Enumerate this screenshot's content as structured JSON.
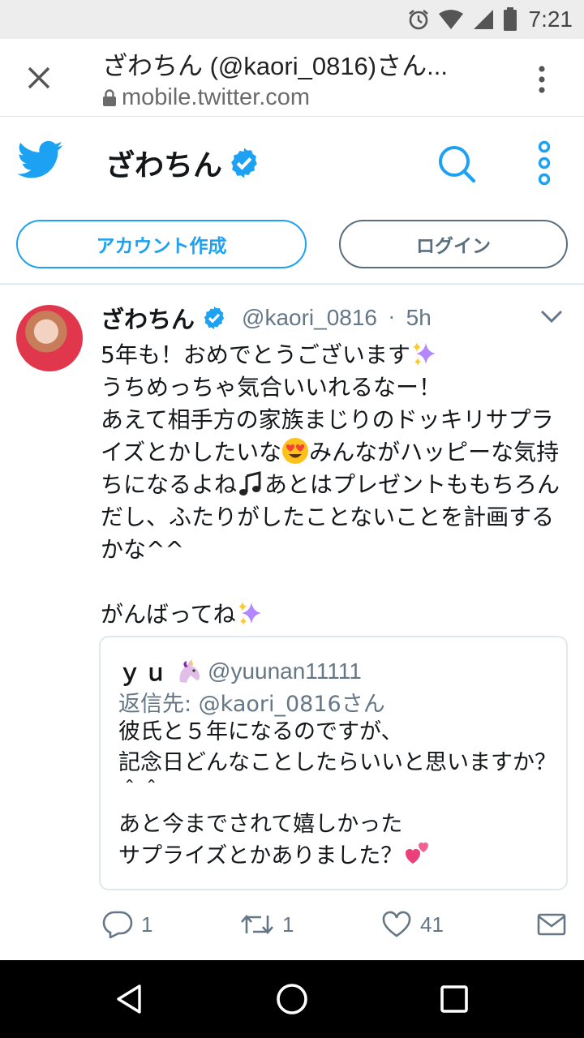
{
  "status_bar": {
    "time": "7:21"
  },
  "browser": {
    "page_title": "ざわちん (@kaori_0816)さん...",
    "url": "mobile.twitter.com"
  },
  "header": {
    "profile_name": "ざわちん",
    "signup_label": "アカウント作成",
    "login_label": "ログイン"
  },
  "tweet": {
    "name": "ざわちん",
    "handle": "@kaori_0816",
    "separator": "·",
    "time": "5h",
    "text_part1": "5年も！おめでとうございます",
    "text_part2": "\nうちめっちゃ気合いいれるなー！\nあえて相手方の家族まじりのドッキリサプライズとかしたいな",
    "text_part3": "みんながハッピーな気持ちになるよね",
    "text_part4": "あとはプレゼントももちろんだし、ふたりがしたことないことを計画するかな^^\n\nがんばってね",
    "quote": {
      "name": "ｙｕ",
      "handle": "@yuunan11111",
      "reply_to": "返信先: @kaori_0816さん",
      "text": "彼氏と５年になるのですが、\n記念日どんなことしたらいいと思いますか？＾＾\nあと今までされて嬉しかった\nサプライズとかありました？"
    },
    "actions": {
      "replies": "1",
      "retweets": "1",
      "likes": "41"
    }
  },
  "colors": {
    "twitter_blue": "#1da1f2",
    "secondary_text": "#657786",
    "status_bar_bg": "#ededed",
    "nav_bar_bg": "#000000"
  },
  "icons": [
    "alarm-icon",
    "wifi-icon",
    "signal-icon",
    "battery-icon",
    "close-icon",
    "lock-icon",
    "overflow-menu-icon",
    "twitter-bird-icon",
    "verified-badge-icon",
    "search-icon",
    "more-vertical-icon",
    "chevron-down-icon",
    "sparkles-emoji",
    "heart-eyes-emoji",
    "music-note-emoji",
    "unicorn-emoji",
    "two-hearts-emoji",
    "reply-icon",
    "retweet-icon",
    "like-icon",
    "direct-message-icon",
    "nav-back-icon",
    "nav-home-icon",
    "nav-recents-icon"
  ]
}
